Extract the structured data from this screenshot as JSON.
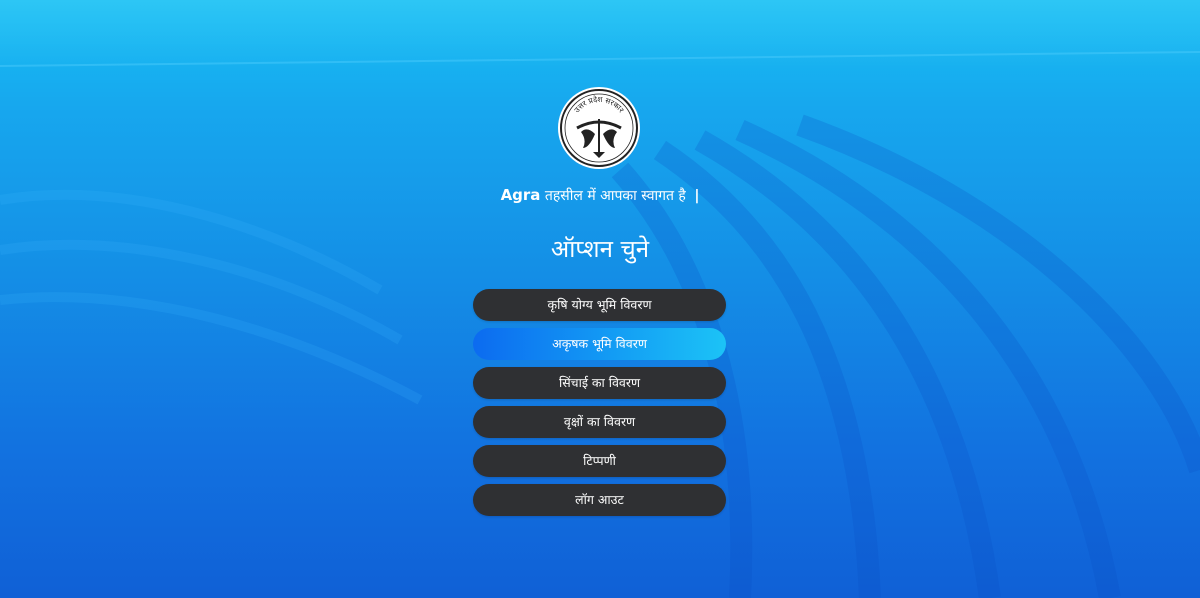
{
  "header": {
    "seal_arc_text": "उत्तर प्रदेश सरकार",
    "tehsil_name": "Agra",
    "welcome_text": "तहसील में आपका स्वागत है",
    "welcome_bar": "|"
  },
  "heading": "ऑप्शन चुने",
  "menu": {
    "active_index": 1,
    "items": [
      {
        "label": "कृषि योग्य भूमि विवरण"
      },
      {
        "label": "अकृषक भूमि विवरण"
      },
      {
        "label": "सिंचाई का विवरण"
      },
      {
        "label": "वृक्षों का विवरण"
      },
      {
        "label": "टिप्पणी"
      },
      {
        "label": "लॉग आउट"
      }
    ]
  },
  "colors": {
    "menu_button_bg": "#2f3033",
    "active_button_start": "#0c6bf0",
    "active_button_end": "#1cc3f6",
    "background_top": "#16c0f4",
    "background_bottom": "#1060d6"
  }
}
